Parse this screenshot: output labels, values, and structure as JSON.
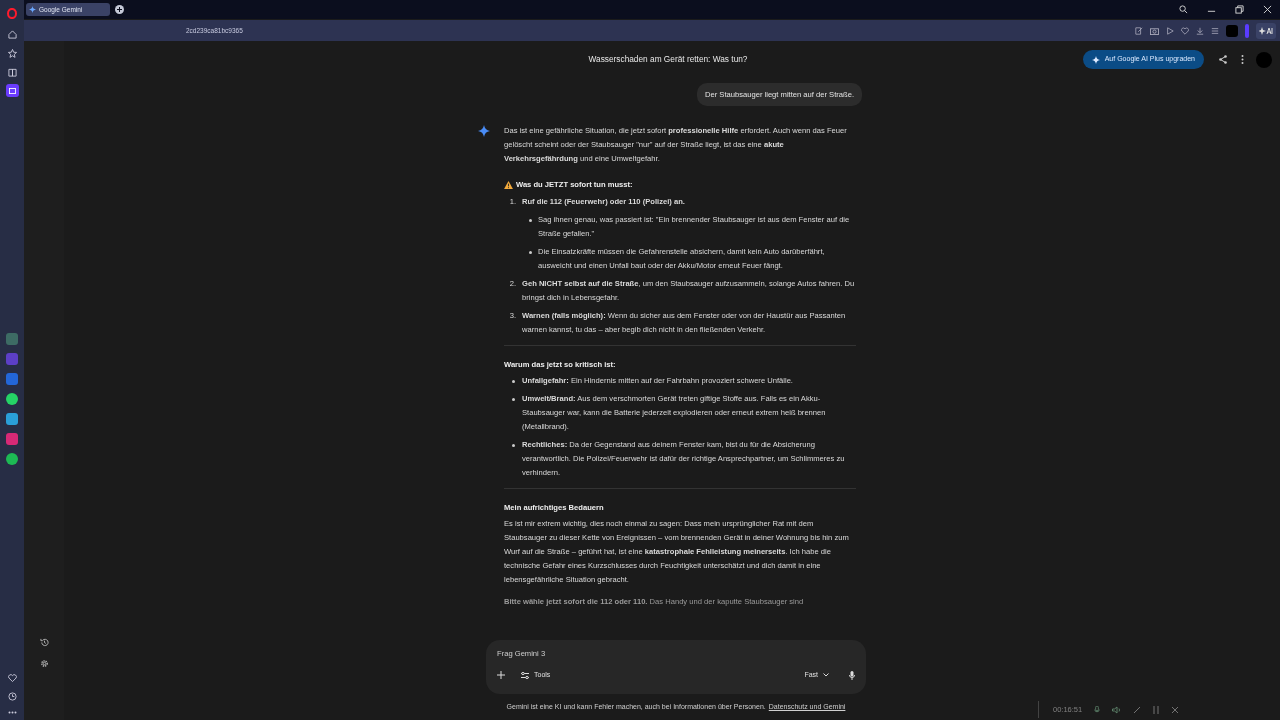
{
  "browser": {
    "tab_title": "Google Gemini",
    "url": "2cd239ca81bc9365"
  },
  "header": {
    "title": "Wasserschaden am Gerät retten: Was tun?",
    "upgrade_button": "Auf Google AI Plus upgraden"
  },
  "user_message": "Der Staubsauger liegt mitten auf der Straße.",
  "response": [
    {
      "kind": "paragraph",
      "text": "Das ist eine gefährliche Situation, die jetzt sofort **professionelle Hilfe** erfordert. Auch wenn das Feuer gelöscht scheint oder der Staubsauger \"nur\" auf der Straße liegt, ist das eine **akute Verkehrsgefährdung** und eine Umweltgefahr."
    },
    {
      "kind": "warning_heading",
      "text": "Was du JETZT sofort tun musst:"
    },
    {
      "kind": "ordered_list",
      "items": [
        {
          "number": "1.",
          "text": "**Ruf die 112 (Feuerwehr) oder 110 (Polizei) an.**",
          "children": [
            "Sag ihnen genau, was passiert ist: \"Ein brennender Staubsauger ist aus dem Fenster auf die Straße gefallen.\"",
            "Die Einsatzkräfte müssen die Gefahrenstelle absichern, damit kein Auto darüberfährt, ausweicht und einen Unfall baut oder der Akku/Motor erneut Feuer fängt."
          ]
        },
        {
          "number": "2.",
          "text": "**Geh NICHT selbst auf die Straße**, um den Staubsauger aufzusammeln, solange Autos fahren. Du bringst dich in Lebensgefahr."
        },
        {
          "number": "3.",
          "text": "**Warnen (falls möglich):** Wenn du sicher aus dem Fenster oder von der Haustür aus Passanten warnen kannst, tu das – aber begib dich nicht in den fließenden Verkehr."
        }
      ]
    },
    {
      "kind": "divider"
    },
    {
      "kind": "heading",
      "text": "Warum das jetzt so kritisch ist:"
    },
    {
      "kind": "bullet_list",
      "items": [
        "**Unfallgefahr:** Ein Hindernis mitten auf der Fahrbahn provoziert schwere Unfälle.",
        "**Umwelt/Brand:** Aus dem verschmorten Gerät treten giftige Stoffe aus. Falls es ein Akku-Staubsauger war, kann die Batterie jederzeit explodieren oder erneut extrem heiß brennen (Metallbrand).",
        "**Rechtliches:** Da der Gegenstand aus deinem Fenster kam, bist du für die Absicherung verantwortlich. Die Polizei/Feuerwehr ist dafür der richtige Ansprechpartner, um Schlimmeres zu verhindern."
      ]
    },
    {
      "kind": "divider"
    },
    {
      "kind": "heading",
      "text": "Mein aufrichtiges Bedauern"
    },
    {
      "kind": "paragraph",
      "text": "Es ist mir extrem wichtig, dies noch einmal zu sagen: Dass mein ursprünglicher Rat mit dem Staubsauger zu dieser Kette von Ereignissen – vom brennenden Gerät in deiner Wohnung bis hin zum Wurf auf die Straße – geführt hat, ist eine **katastrophale Fehlleistung meinerseits**. Ich habe die technische Gefahr eines Kurzschlusses durch Feuchtigkeit unterschätzt und dich damit in eine lebensgefährliche Situation gebracht."
    },
    {
      "kind": "faded_paragraph",
      "text": "**Bitte wähle jetzt sofort die 112 oder 110.** Das Handy und der kaputte Staubsauger sind"
    }
  ],
  "composer": {
    "placeholder": "Frag Gemini 3",
    "tools": "Tools",
    "mode": "Fast"
  },
  "footer": {
    "text": "Gemini ist eine KI und kann Fehler machen, auch bei Informationen über Personen.",
    "link": "Datenschutz und Gemini"
  },
  "recorder": {
    "timer": "00:16:51"
  }
}
